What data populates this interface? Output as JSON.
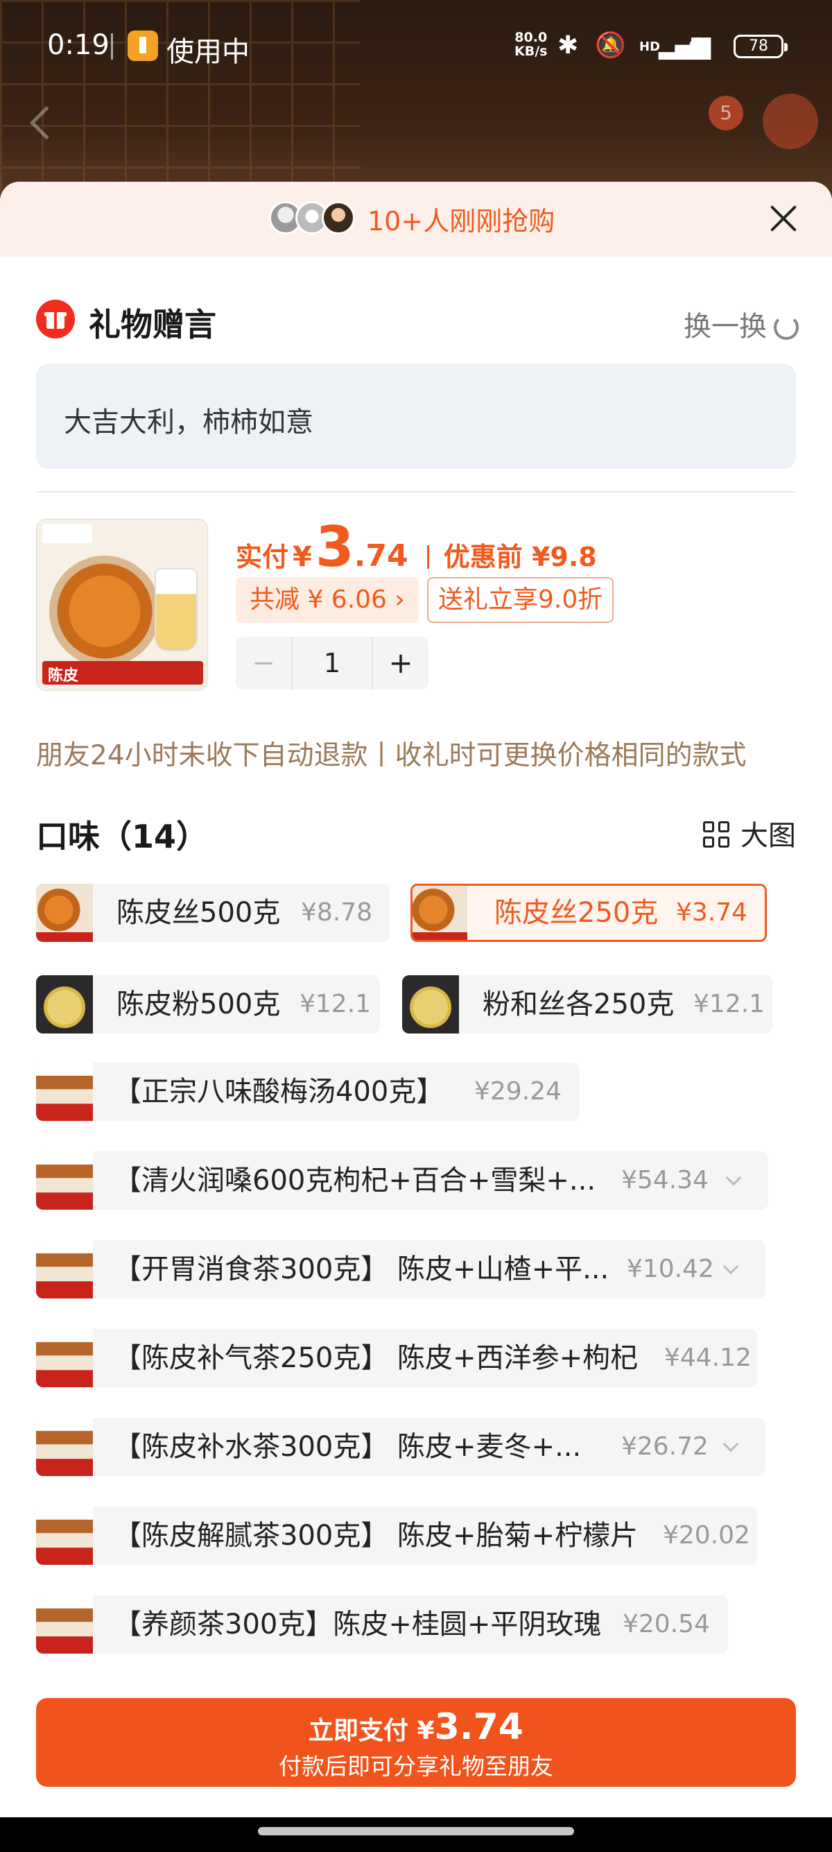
{
  "status_bar": {
    "time": "0:19",
    "activity_label": "使用中",
    "net_speed_value": "80.0",
    "net_speed_unit": "KB/s",
    "hd_label": "HD",
    "battery": "78"
  },
  "background": {
    "cart_badge": "5"
  },
  "banner": {
    "buyers_text": "10+人刚刚抢购"
  },
  "gift_message": {
    "title": "礼物赠言",
    "swap_label": "换一换",
    "text": "大吉大利，柿柿如意"
  },
  "product": {
    "image_label": "陈皮",
    "pay_label": "实付",
    "currency": "¥",
    "price_int": "3",
    "price_dec": ".74",
    "original_label": "优惠前 ¥9.8",
    "discount_chip": "共减 ¥ 6.06 ›",
    "gift_offer_chip": "送礼立享9.0折",
    "quantity": "1",
    "minus": "−",
    "plus": "+"
  },
  "notice": "朋友24小时未收下自动退款丨收礼时可更换价格相同的款式",
  "flavors": {
    "heading": "口味（14）",
    "big_view_label": "大图",
    "options": [
      {
        "name": "陈皮丝500克",
        "price": "¥8.78",
        "selected": false
      },
      {
        "name": "陈皮丝250克",
        "price": "¥3.74",
        "selected": true
      },
      {
        "name": "陈皮粉500克",
        "price": "¥12.1",
        "selected": false
      },
      {
        "name": "粉和丝各250克",
        "price": "¥12.1",
        "selected": false
      },
      {
        "name": "【正宗八味酸梅汤400克】",
        "price": "¥29.24",
        "selected": false
      },
      {
        "name": "【清火润嗓600克枸杞+百合+雪梨+...",
        "price": "¥54.34",
        "selected": false
      },
      {
        "name": "【开胃消食茶300克】 陈皮+山楂+平...",
        "price": "¥10.42",
        "selected": false
      },
      {
        "name": "【陈皮补气茶250克】 陈皮+西洋参+枸杞",
        "price": "¥44.12",
        "selected": false
      },
      {
        "name": "【陈皮补水茶300克】 陈皮+麦冬+...",
        "price": "¥26.72",
        "selected": false
      },
      {
        "name": "【陈皮解腻茶300克】 陈皮+胎菊+柠檬片",
        "price": "¥20.02",
        "selected": false
      },
      {
        "name": "【养颜茶300克】陈皮+桂圆+平阴玫瑰",
        "price": "¥20.54",
        "selected": false
      }
    ]
  },
  "pay_button": {
    "label": "立即支付",
    "currency": "¥",
    "amount": "3.74",
    "subtitle": "付款后即可分享礼物至朋友"
  },
  "colors": {
    "accent": "#f05a1e",
    "gift_red": "#f02d1e",
    "banner_bg": "#fdf0ea"
  }
}
